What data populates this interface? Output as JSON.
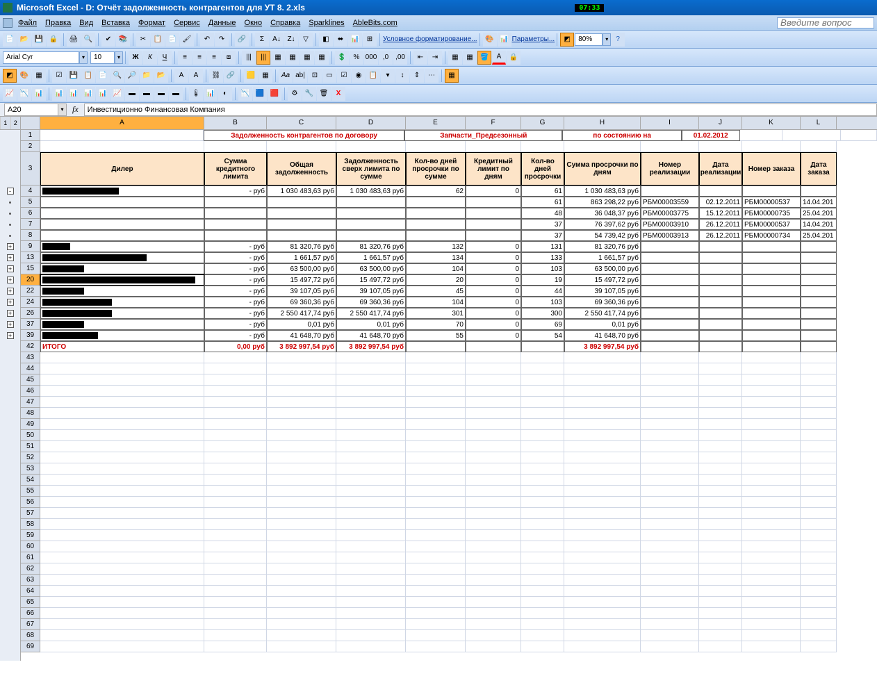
{
  "title_bar": {
    "app": "Microsoft Excel",
    "doc": "D: Отчёт задолженность контрагентов для УТ 8. 2.xls",
    "clock": "07:33"
  },
  "menu": {
    "file": "Файл",
    "edit": "Правка",
    "view": "Вид",
    "insert": "Вставка",
    "format": "Формат",
    "service": "Сервис",
    "data": "Данные",
    "window": "Окно",
    "help": "Справка",
    "sparklines": "Sparklines",
    "ablebits": "AbleBits.com",
    "search_placeholder": "Введите вопрос"
  },
  "toolbar": {
    "cond_fmt": "Условное форматирование...",
    "params": "Параметры...",
    "zoom": "80%"
  },
  "format_bar": {
    "font": "Arial Cyr",
    "size": "10"
  },
  "name_box": "A20",
  "formula": "Инвестиционно Финансовая Компания",
  "outline_levels": [
    "1",
    "2"
  ],
  "columns": [
    "A",
    "B",
    "C",
    "D",
    "E",
    "F",
    "G",
    "H",
    "I",
    "J",
    "K",
    "L"
  ],
  "row1": {
    "title": "Задолженность контрагентов по договору",
    "doc_type": "Запчасти_Предсезонный",
    "asof_label": "по состоянию на",
    "asof_date": "01.02.2012"
  },
  "headers": {
    "dealer": "Дилер",
    "credit_limit": "Сумма кредитного лимита",
    "total_debt": "Общая задолженность",
    "over_limit": "Задолженность сверх лимита по сумме",
    "days_over_sum": "Кол-во дней просрочки по сумме",
    "credit_days": "Кредитный лимит по дням",
    "days_over": "Кол-во дней просрочки",
    "overdue_amt": "Сумма просрочки по дням",
    "sale_no": "Номер реализации",
    "sale_date": "Дата реализации",
    "order_no": "Номер заказа",
    "order_date": "Дата заказа"
  },
  "rows": [
    {
      "n": "4",
      "ctrl": "-",
      "rw": 110,
      "B": "-   руб",
      "C": "1 030 483,63 руб",
      "D": "1 030 483,63 руб",
      "E": "62",
      "F": "0",
      "G": "61",
      "H": "1 030 483,63 руб"
    },
    {
      "n": "5",
      "ctrl": ".",
      "B": "",
      "C": "",
      "D": "",
      "E": "",
      "F": "",
      "G": "61",
      "H": "863 298,22 руб",
      "I": "РБМ00003559",
      "J": "02.12.2011",
      "K": "РБМ00000537",
      "L": "14.04.201"
    },
    {
      "n": "6",
      "ctrl": ".",
      "B": "",
      "C": "",
      "D": "",
      "E": "",
      "F": "",
      "G": "48",
      "H": "36 048,37 руб",
      "I": "РБМ00003775",
      "J": "15.12.2011",
      "K": "РБМ00000735",
      "L": "25.04.201"
    },
    {
      "n": "7",
      "ctrl": ".",
      "B": "",
      "C": "",
      "D": "",
      "E": "",
      "F": "",
      "G": "37",
      "H": "76 397,62 руб",
      "I": "РБМ00003910",
      "J": "26.12.2011",
      "K": "РБМ00000537",
      "L": "14.04.201"
    },
    {
      "n": "8",
      "ctrl": ".",
      "B": "",
      "C": "",
      "D": "",
      "E": "",
      "F": "",
      "G": "37",
      "H": "54 739,42 руб",
      "I": "РБМ00003913",
      "J": "26.12.2011",
      "K": "РБМ00000734",
      "L": "25.04.201"
    },
    {
      "n": "9",
      "ctrl": "+",
      "rw": 40,
      "B": "-   руб",
      "C": "81 320,76 руб",
      "D": "81 320,76 руб",
      "E": "132",
      "F": "0",
      "G": "131",
      "H": "81 320,76 руб"
    },
    {
      "n": "13",
      "ctrl": "+",
      "rw": 150,
      "B": "-   руб",
      "C": "1 661,57 руб",
      "D": "1 661,57 руб",
      "E": "134",
      "F": "0",
      "G": "133",
      "H": "1 661,57 руб"
    },
    {
      "n": "15",
      "ctrl": "+",
      "rw": 60,
      "B": "-   руб",
      "C": "63 500,00 руб",
      "D": "63 500,00 руб",
      "E": "104",
      "F": "0",
      "G": "103",
      "H": "63 500,00 руб"
    },
    {
      "n": "20",
      "ctrl": "+",
      "sel": true,
      "rw": 220,
      "B": "-   руб",
      "C": "15 497,72 руб",
      "D": "15 497,72 руб",
      "E": "20",
      "F": "0",
      "G": "19",
      "H": "15 497,72 руб"
    },
    {
      "n": "22",
      "ctrl": "+",
      "rw": 60,
      "B": "-   руб",
      "C": "39 107,05 руб",
      "D": "39 107,05 руб",
      "E": "45",
      "F": "0",
      "G": "44",
      "H": "39 107,05 руб"
    },
    {
      "n": "24",
      "ctrl": "+",
      "rw": 100,
      "B": "-   руб",
      "C": "69 360,36 руб",
      "D": "69 360,36 руб",
      "E": "104",
      "F": "0",
      "G": "103",
      "H": "69 360,36 руб"
    },
    {
      "n": "26",
      "ctrl": "+",
      "rw": 100,
      "B": "-   руб",
      "C": "2 550 417,74 руб",
      "D": "2 550 417,74 руб",
      "E": "301",
      "F": "0",
      "G": "300",
      "H": "2 550 417,74 руб"
    },
    {
      "n": "37",
      "ctrl": "+",
      "rw": 60,
      "B": "-   руб",
      "C": "0,01 руб",
      "D": "0,01 руб",
      "E": "70",
      "F": "0",
      "G": "69",
      "H": "0,01 руб"
    },
    {
      "n": "39",
      "ctrl": "+",
      "rw": 80,
      "B": "-   руб",
      "C": "41 648,70 руб",
      "D": "41 648,70 руб",
      "E": "55",
      "F": "0",
      "G": "54",
      "H": "41 648,70 руб"
    }
  ],
  "total": {
    "n": "42",
    "label": "ИТОГО",
    "B": "0,00 руб",
    "C": "3 892 997,54 руб",
    "D": "3 892 997,54 руб",
    "H": "3 892 997,54 руб"
  },
  "empty_rows": [
    "43",
    "44",
    "45",
    "46",
    "47",
    "48",
    "49",
    "50",
    "51",
    "52",
    "53",
    "54",
    "55",
    "56",
    "57",
    "58",
    "59",
    "60",
    "61",
    "62",
    "63",
    "64",
    "65",
    "66",
    "67",
    "68",
    "69"
  ]
}
